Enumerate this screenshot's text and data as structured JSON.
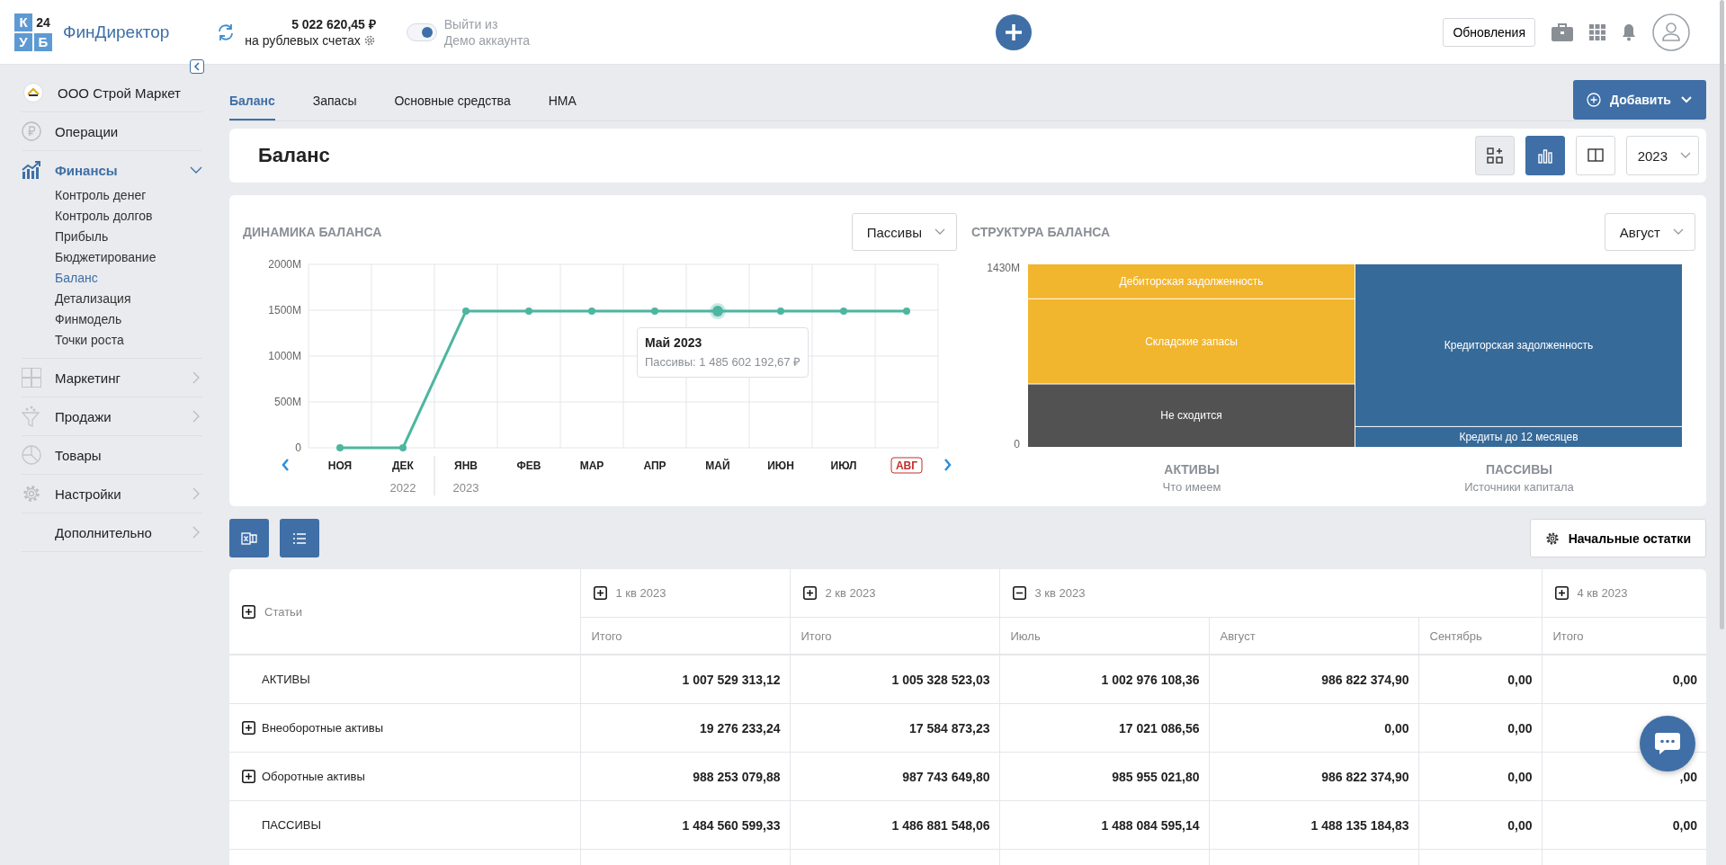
{
  "header": {
    "logo": [
      "К",
      "24",
      "У",
      "Б"
    ],
    "app_name": "ФинДиректор",
    "balance": {
      "amount": "5 022 620,45 ₽",
      "caption": "на рублевых счетах"
    },
    "demo": {
      "on": true,
      "label": "Выйти из\nДемо аккаунта"
    },
    "updates_button": "Обновления"
  },
  "sidebar": {
    "org": "ООО Строй Маркет",
    "items": [
      {
        "label": "Операции",
        "kind": "link",
        "selected": false
      },
      {
        "label": "Финансы",
        "kind": "group",
        "selected": true,
        "expanded": true,
        "children": [
          {
            "label": "Контроль денег",
            "selected": false
          },
          {
            "label": "Контроль долгов",
            "selected": false
          },
          {
            "label": "Прибыль",
            "selected": false
          },
          {
            "label": "Бюджетирование",
            "selected": false
          },
          {
            "label": "Баланс",
            "selected": true
          },
          {
            "label": "Детализация",
            "selected": false
          },
          {
            "label": "Финмодель",
            "selected": false
          },
          {
            "label": "Точки роста",
            "selected": false
          }
        ]
      },
      {
        "label": "Маркетинг",
        "kind": "group",
        "selected": false,
        "expanded": false
      },
      {
        "label": "Продажи",
        "kind": "group",
        "selected": false,
        "expanded": false
      },
      {
        "label": "Товары",
        "kind": "link",
        "selected": false
      },
      {
        "label": "Настройки",
        "kind": "group",
        "selected": false,
        "expanded": false
      },
      {
        "label": "Дополнительно",
        "kind": "group",
        "selected": false,
        "expanded": false
      }
    ]
  },
  "tabs": [
    {
      "label": "Баланс",
      "selected": true
    },
    {
      "label": "Запасы",
      "selected": false
    },
    {
      "label": "Основные средства",
      "selected": false
    },
    {
      "label": "НМА",
      "selected": false
    }
  ],
  "add_button": "Добавить",
  "balance_card": {
    "title": "Баланс",
    "view_buttons": [
      {
        "selected": false
      },
      {
        "selected": true
      },
      {
        "selected": false
      }
    ],
    "year": "2023"
  },
  "dynamics": {
    "title": "ДИНАМИКА БАЛАНСА",
    "filter": "Пассивы",
    "tooltip_title": "Май 2023",
    "periods": [
      {
        "label": "2022",
        "months": [
          {
            "selected": false,
            "hovered": false
          },
          {
            "selected": false,
            "hovered": false
          }
        ]
      },
      {
        "label": "2023",
        "months": [
          {
            "selected": false,
            "hovered": false
          },
          {
            "selected": false,
            "hovered": false
          },
          {
            "selected": false,
            "hovered": false
          },
          {
            "selected": false,
            "hovered": false
          },
          {
            "selected": false,
            "hovered": true
          },
          {
            "selected": false,
            "hovered": false
          },
          {
            "selected": false,
            "hovered": false
          },
          {
            "selected": true,
            "hovered": false
          }
        ]
      }
    ],
    "chart_data": {
      "type": "line",
      "categories": [
        "НОЯ",
        "ДЕК",
        "ЯНВ",
        "ФЕВ",
        "МАР",
        "АПР",
        "МАЙ",
        "ИЮН",
        "ИЮЛ",
        "АВГ"
      ],
      "grid": true,
      "series": [
        {
          "color": "#4db6a0",
          "marker": "circle",
          "values": [
            0,
            0,
            1490,
            1490,
            1490,
            1490,
            1490,
            1490,
            1490,
            1490
          ]
        }
      ],
      "ylim": [
        0,
        2000
      ],
      "yticks": [
        {
          "value": 0,
          "label": "0"
        },
        {
          "value": 500,
          "label": "500M"
        },
        {
          "value": 1000,
          "label": "1000M"
        },
        {
          "value": 1500,
          "label": "1500M"
        },
        {
          "value": 2000,
          "label": "2000M"
        }
      ],
      "annotations": [
        "Пассивы: 1 485 602 192,67 ₽"
      ]
    }
  },
  "structure": {
    "title": "СТРУКТУРА БАЛАНСА",
    "month": "Август",
    "captions": [
      "Что имеем",
      "Источники капитала"
    ],
    "chart_data": {
      "type": "bar",
      "stacked": true,
      "categories": [
        "АКТИВЫ",
        "ПАССИВЫ"
      ],
      "series": [
        {
          "name": "Не сходится",
          "color": "#525252",
          "values": [
            494,
            null
          ]
        },
        {
          "name": "Складские запасы",
          "color": "#f2b52e",
          "values": [
            664,
            null
          ]
        },
        {
          "name": "Дебиторская задолженность",
          "color": "#f2b52e",
          "values": [
            272,
            null
          ]
        },
        {
          "name": "Кредиты до 12 месяцев",
          "color": "#366a99",
          "values": [
            null,
            162
          ]
        },
        {
          "name": "Кредиторская задолженность",
          "color": "#366a99",
          "values": [
            null,
            1268
          ]
        }
      ],
      "ylim": [
        0,
        1430
      ],
      "yticks": [
        {
          "value": 0,
          "label": "0"
        },
        {
          "value": 1430,
          "label": "1430M"
        }
      ]
    }
  },
  "opening_balances_button": "Начальные остатки",
  "table": {
    "articles": {
      "label": "Статьи",
      "expanded": false
    },
    "quarters": [
      {
        "label": "1 кв 2023",
        "expanded": false,
        "columns": [
          "Итого"
        ]
      },
      {
        "label": "2 кв 2023",
        "expanded": false,
        "columns": [
          "Итого"
        ]
      },
      {
        "label": "3 кв 2023",
        "expanded": true,
        "columns": [
          "Июль",
          "Август",
          "Сентябрь"
        ]
      },
      {
        "label": "4 кв 2023",
        "expanded": false,
        "columns": [
          "Итого"
        ]
      }
    ],
    "rows": [
      {
        "label": "АКТИВЫ",
        "kind": "total",
        "values": [
          "1 007 529 313,12",
          "1 005 328 523,03",
          "1 002 976 108,36",
          "986 822 374,90",
          "0,00",
          "0,00"
        ]
      },
      {
        "label": "Внеоборотные активы",
        "kind": "group",
        "expanded": false,
        "values": [
          "19 276 233,24",
          "17 584 873,23",
          "17 021 086,56",
          "0,00",
          "0,00"
        ]
      },
      {
        "label": "Оборотные активы",
        "kind": "group",
        "expanded": false,
        "values": [
          "988 253 079,88",
          "987 743 649,80",
          "985 955 021,80",
          "986 822 374,90",
          "0,00",
          ",00"
        ]
      },
      {
        "label": "ПАССИВЫ",
        "kind": "total",
        "values": [
          "1 484 560 599,33",
          "1 486 881 548,06",
          "1 488 084 595,14",
          "1 488 135 184,83",
          "0,00",
          "0,00"
        ]
      }
    ]
  }
}
